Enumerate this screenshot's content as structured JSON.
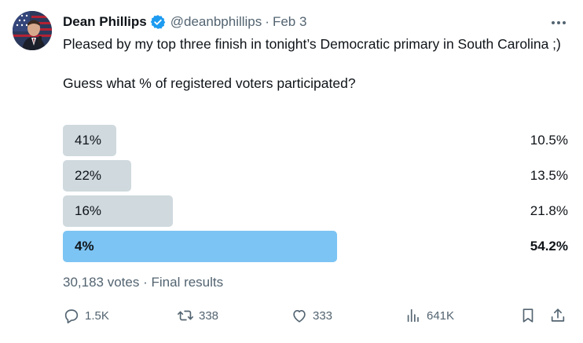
{
  "author": {
    "name": "Dean Phillips",
    "handle": "@deanbphillips",
    "separator": "·",
    "date": "Feb 3"
  },
  "tweet": {
    "text_line1": "Pleased by my top three finish in tonight’s Democratic primary in South Carolina ;)",
    "text_line2": "Guess what % of registered voters participated?"
  },
  "poll": {
    "options": [
      {
        "label": "41%",
        "percent": "10.5%",
        "fraction": 0.105,
        "winner": false
      },
      {
        "label": "22%",
        "percent": "13.5%",
        "fraction": 0.135,
        "winner": false
      },
      {
        "label": "16%",
        "percent": "21.8%",
        "fraction": 0.218,
        "winner": false
      },
      {
        "label": "4%",
        "percent": "54.2%",
        "fraction": 0.542,
        "winner": true
      }
    ],
    "votes": "30,183 votes",
    "meta_separator": "·",
    "status": "Final results"
  },
  "actions": {
    "reply": {
      "icon": "reply-icon",
      "count": "1.5K"
    },
    "repost": {
      "icon": "repost-icon",
      "count": "338"
    },
    "like": {
      "icon": "heart-icon",
      "count": "333"
    },
    "views": {
      "icon": "analytics-icon",
      "count": "641K"
    },
    "bookmark": {
      "icon": "bookmark-icon"
    },
    "share": {
      "icon": "share-icon"
    }
  },
  "colors": {
    "text": "#0f1419",
    "secondary": "#536471",
    "bar": "#cfd9de",
    "winner_bar": "#7cc4f3",
    "verified": "#1d9bf0"
  }
}
